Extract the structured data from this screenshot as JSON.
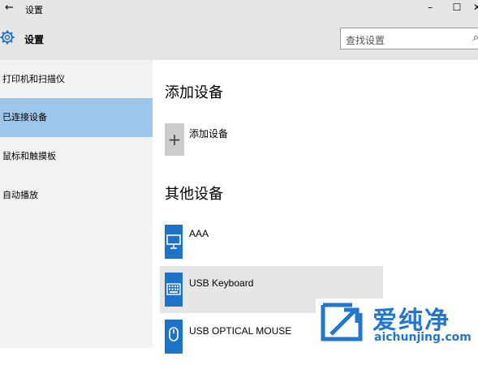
{
  "window": {
    "title": "设置",
    "back_icon": "back-arrow-icon",
    "minimize_glyph": "–",
    "maximize_glyph": "☐",
    "close_glyph": "✕"
  },
  "header": {
    "app_name": "设置",
    "icon": "gear-icon",
    "search_placeholder": "查找设置",
    "search_icon": "search-icon"
  },
  "sidebar": {
    "items": [
      {
        "label": "打印机和扫描仪",
        "active": false
      },
      {
        "label": "已连接设备",
        "active": true
      },
      {
        "label": "鼠标和触摸板",
        "active": false
      },
      {
        "label": "自动播放",
        "active": false
      }
    ]
  },
  "main": {
    "add_section_title": "添加设备",
    "add_button_glyph": "+",
    "add_button_label": "添加设备",
    "other_section_title": "其他设备",
    "devices": [
      {
        "label": "AAA",
        "icon": "monitor-icon"
      },
      {
        "label": "USB Keyboard",
        "icon": "keyboard-icon"
      },
      {
        "label": "USB OPTICAL MOUSE",
        "icon": "mouse-icon"
      }
    ]
  },
  "watermark": {
    "name": "爱纯净",
    "url": "aichunjing.com",
    "color": "#2277cc"
  },
  "colors": {
    "active_nav": "#9cc6ea",
    "device_icon_bg": "#1e73c8",
    "chrome_bg": "#e6e6e6",
    "sidebar_bg": "#f2f2f2"
  }
}
